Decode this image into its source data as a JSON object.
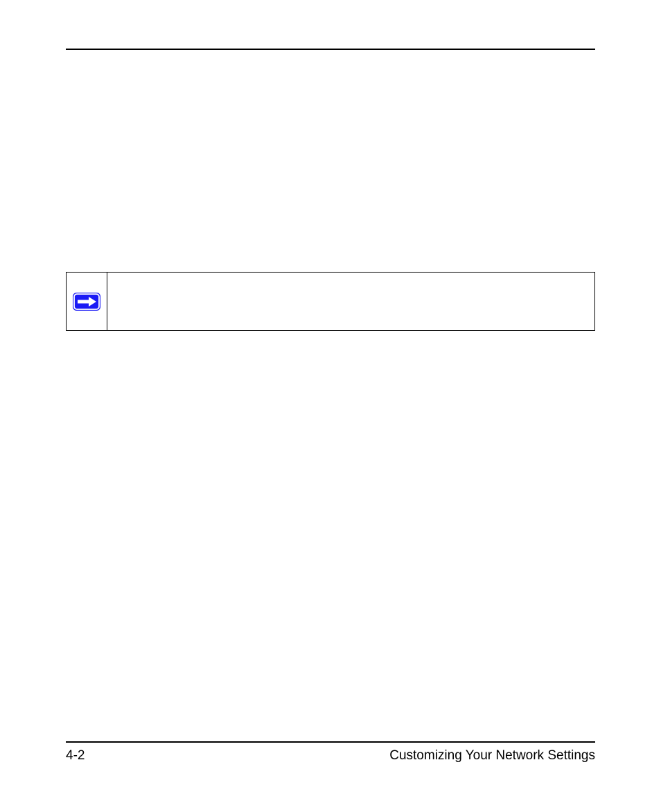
{
  "note": {
    "text": ""
  },
  "footer": {
    "page_number": "4-2",
    "section_title": "Customizing Your Network Settings"
  }
}
